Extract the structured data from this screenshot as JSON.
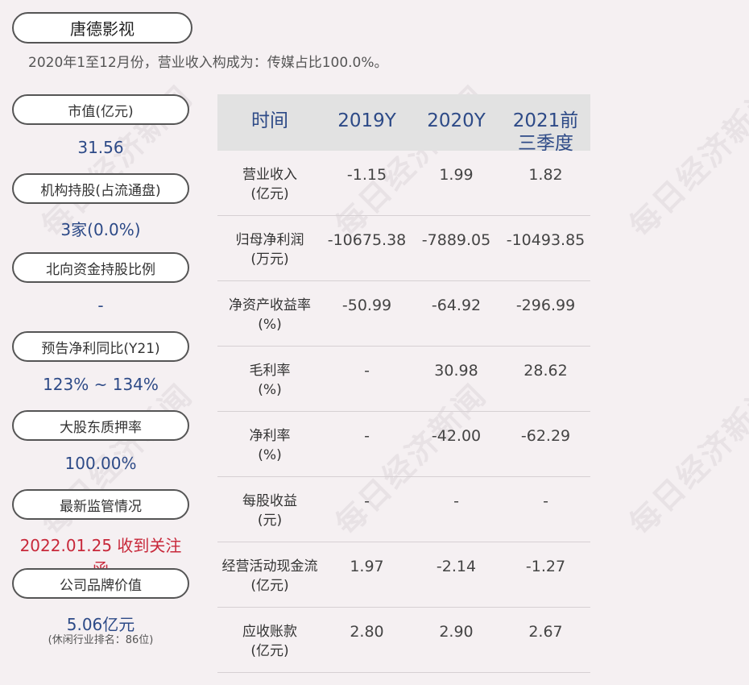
{
  "company_name": "唐德影视",
  "summary": "2020年1至12月份，营业收入构成为：传媒占比100.0%。",
  "watermark": "每日经济新闻",
  "metrics": [
    {
      "label": "市值(亿元)",
      "value": "31.56"
    },
    {
      "label": "机构持股(占流通盘)",
      "value": "3家(0.0%)"
    },
    {
      "label": "北向资金持股比例",
      "value": "-"
    },
    {
      "label": "预告净利同比(Y21)",
      "value": "123% ~ 134%"
    },
    {
      "label": "大股东质押率",
      "value": "100.00%"
    },
    {
      "label": "最新监管情况",
      "value": "2022.01.25 收到关注函"
    },
    {
      "label": "公司品牌价值",
      "value": "5.06亿元",
      "note": "(休闲行业排名：86位)"
    }
  ],
  "table": {
    "headers": [
      "时间",
      "2019Y",
      "2020Y",
      "2021前三季度"
    ],
    "rows": [
      {
        "label": "营业收入\n(亿元)",
        "values": [
          "-1.15",
          "1.99",
          "1.82"
        ]
      },
      {
        "label": "归母净利润\n(万元)",
        "values": [
          "-10675.38",
          "-7889.05",
          "-10493.85"
        ]
      },
      {
        "label": "净资产收益率\n(%)",
        "values": [
          "-50.99",
          "-64.92",
          "-296.99"
        ]
      },
      {
        "label": "毛利率\n(%)",
        "values": [
          "-",
          "30.98",
          "28.62"
        ]
      },
      {
        "label": "净利率\n(%)",
        "values": [
          "-",
          "-42.00",
          "-62.29"
        ]
      },
      {
        "label": "每股收益\n(元)",
        "values": [
          "-",
          "-",
          "-"
        ]
      },
      {
        "label": "经营活动现金流\n(亿元)",
        "values": [
          "1.97",
          "-2.14",
          "-1.27"
        ]
      },
      {
        "label": "应收账款\n(亿元)",
        "values": [
          "2.80",
          "2.90",
          "2.67"
        ]
      }
    ]
  },
  "colors": {
    "background": "#f5f0f2",
    "value_blue": "#2d4a87",
    "alert_red": "#c8283a",
    "header_gray": "#e2e2e2"
  }
}
